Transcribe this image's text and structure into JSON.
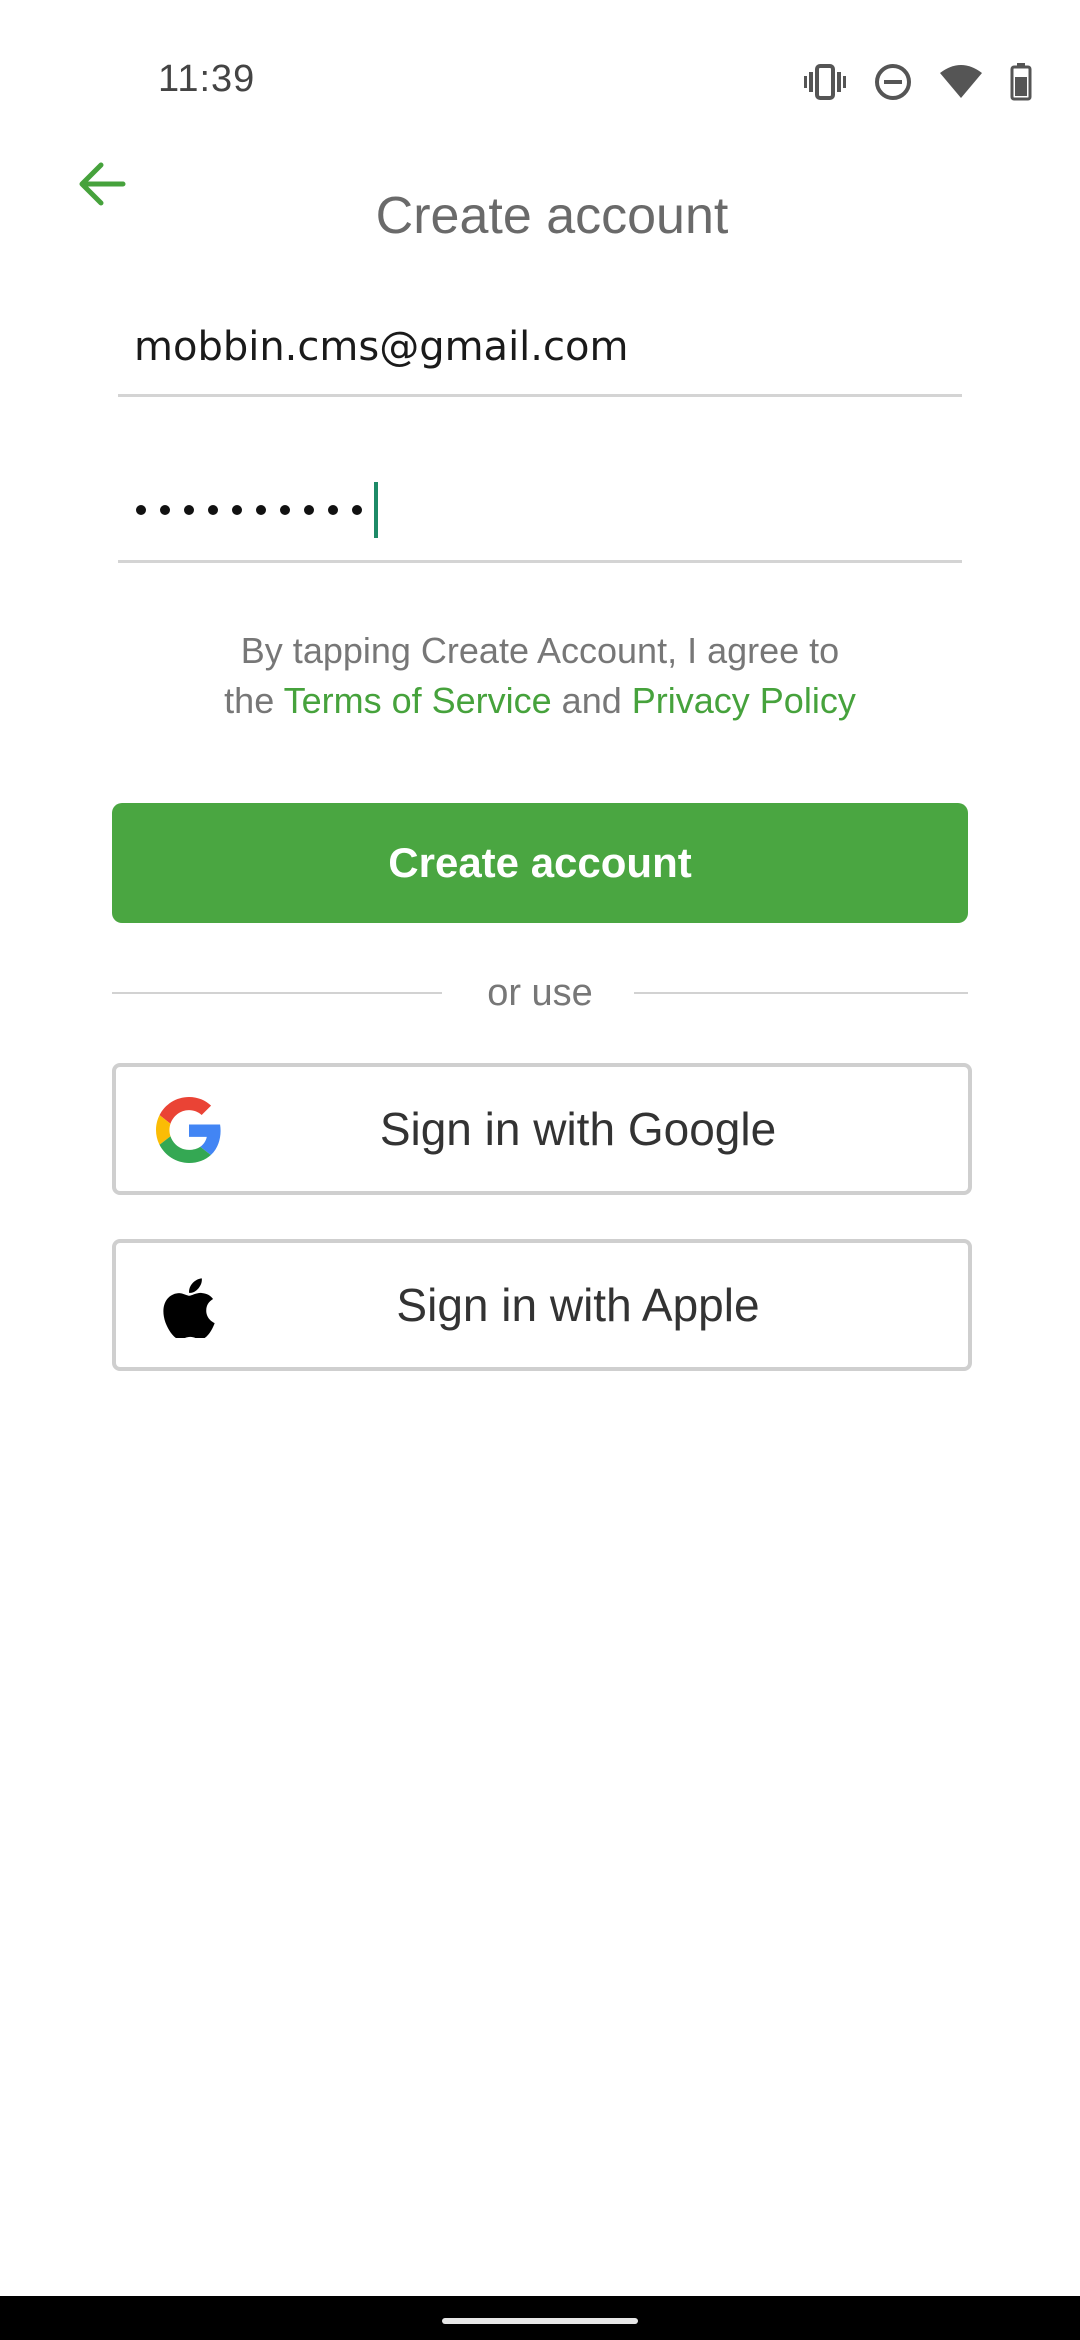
{
  "status_bar": {
    "time": "11:39",
    "icons": [
      "vibrate-icon",
      "do-not-disturb-icon",
      "wifi-icon",
      "battery-icon"
    ]
  },
  "header": {
    "back_icon": "arrow-left-icon",
    "title": "Create account"
  },
  "form": {
    "email_value": "mobbin.cms@gmail.com",
    "password_length": 10
  },
  "terms": {
    "line1": "By tapping Create Account, I agree to",
    "prefix": "the",
    "terms_link": "Terms of Service",
    "conjunction": "and",
    "privacy_link": "Privacy Policy"
  },
  "primary_button": {
    "label": "Create account"
  },
  "divider": {
    "label": "or use"
  },
  "social": {
    "google_label": "Sign in with Google",
    "apple_label": "Sign in with Apple"
  },
  "colors": {
    "accent": "#4aa641",
    "link": "#46a23c",
    "caret": "#1d8a67"
  }
}
